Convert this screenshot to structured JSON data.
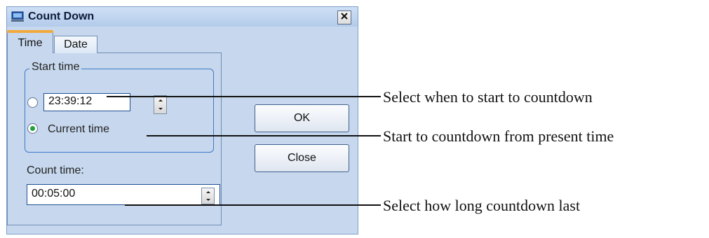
{
  "window": {
    "title": "Count Down",
    "close_glyph": "✕"
  },
  "tabs": [
    {
      "label": "Time"
    },
    {
      "label": "Date"
    }
  ],
  "start_group": {
    "legend": "Start time",
    "time_value": "23:39:12",
    "current_label": "Current time",
    "selected": "Current time"
  },
  "count": {
    "label": "Count time:",
    "value": "00:05:00"
  },
  "buttons": {
    "ok": "OK",
    "close": "Close"
  },
  "callouts": [
    "Select when to start to countdown",
    "Start to countdown from present time",
    "Select how long countdown last"
  ],
  "colors": {
    "dialog_bg": "#c7d8ee",
    "tab_accent": "#f2a93b",
    "group_border": "#3e78c6",
    "radio_selected": "#22a03a"
  }
}
